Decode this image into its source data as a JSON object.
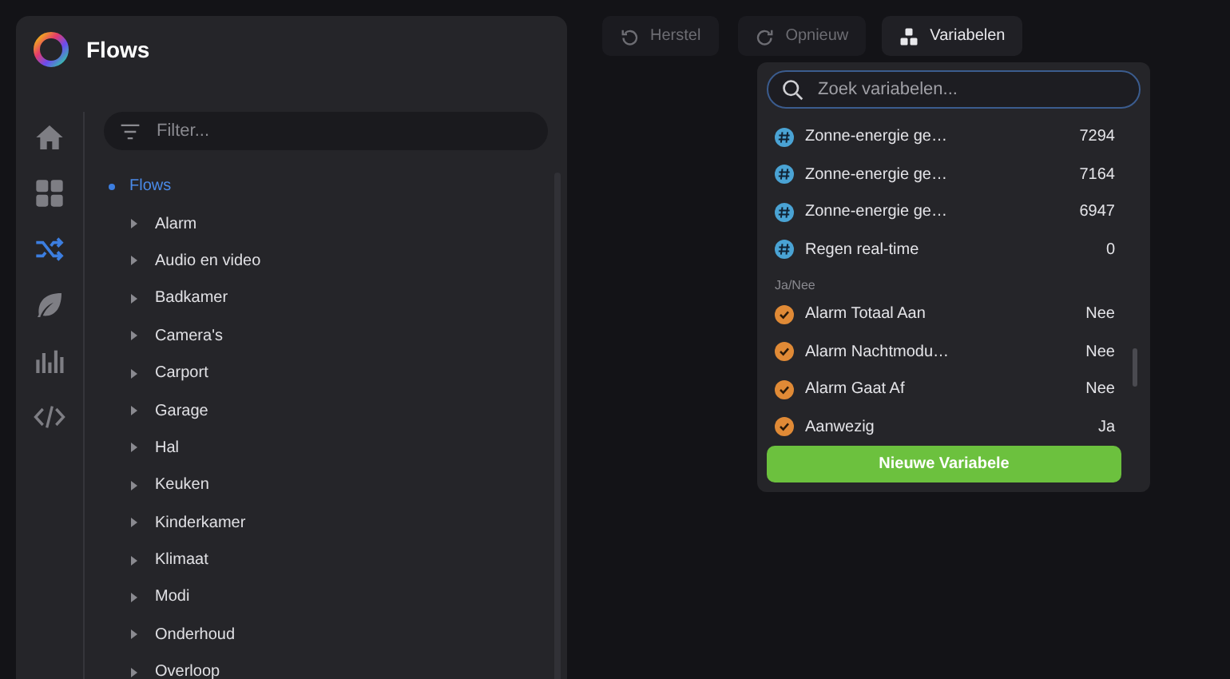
{
  "sidebar": {
    "title": "Flows",
    "nav": [
      {
        "kind": "home",
        "selected": false
      },
      {
        "kind": "grid",
        "selected": false
      },
      {
        "kind": "flows",
        "selected": true
      },
      {
        "kind": "leaf",
        "selected": false
      },
      {
        "kind": "chart",
        "selected": false
      },
      {
        "kind": "code",
        "selected": false
      }
    ],
    "filter": {
      "placeholder": "Filter..."
    },
    "tree": {
      "label": "Flows",
      "selected": true,
      "children": [
        {
          "label": "Alarm",
          "selected": false,
          "expanded": false
        },
        {
          "label": "Audio en video",
          "selected": false,
          "expanded": false
        },
        {
          "label": "Badkamer",
          "selected": false,
          "expanded": false
        },
        {
          "label": "Camera's",
          "selected": false,
          "expanded": false
        },
        {
          "label": "Carport",
          "selected": false,
          "expanded": false
        },
        {
          "label": "Garage",
          "selected": false,
          "expanded": false
        },
        {
          "label": "Hal",
          "selected": false,
          "expanded": false
        },
        {
          "label": "Keuken",
          "selected": false,
          "expanded": false
        },
        {
          "label": "Kinderkamer",
          "selected": false,
          "expanded": false
        },
        {
          "label": "Klimaat",
          "selected": false,
          "expanded": false
        },
        {
          "label": "Modi",
          "selected": false,
          "expanded": false
        },
        {
          "label": "Onderhoud",
          "selected": false,
          "expanded": false
        },
        {
          "label": "Overloop",
          "selected": false,
          "expanded": false
        }
      ]
    }
  },
  "toolbar": [
    {
      "label": "Herstel",
      "kind": "undo",
      "disabled": true
    },
    {
      "label": "Opnieuw",
      "kind": "redo",
      "disabled": true
    },
    {
      "label": "Variabelen",
      "kind": "blocks",
      "disabled": false
    }
  ],
  "variables_popup": {
    "search": {
      "placeholder": "Zoek variabelen..."
    },
    "sections": [
      {
        "items": [
          {
            "kind": "number",
            "name": "Zonne-energie ge…",
            "value": "7294"
          },
          {
            "kind": "number",
            "name": "Zonne-energie ge…",
            "value": "7164"
          },
          {
            "kind": "number",
            "name": "Zonne-energie ge…",
            "value": "6947"
          },
          {
            "kind": "number",
            "name": "Regen real-time",
            "value": "0"
          }
        ]
      },
      {
        "heading": "Ja/Nee",
        "items": [
          {
            "kind": "boolean",
            "name": "Alarm Totaal Aan",
            "value": "Nee"
          },
          {
            "kind": "boolean",
            "name": "Alarm Nachtmodu…",
            "value": "Nee"
          },
          {
            "kind": "boolean",
            "name": "Alarm Gaat Af",
            "value": "Nee"
          },
          {
            "kind": "boolean",
            "name": "Aanwezig",
            "value": "Ja"
          }
        ]
      }
    ],
    "button": "Nieuwe Variabele"
  }
}
